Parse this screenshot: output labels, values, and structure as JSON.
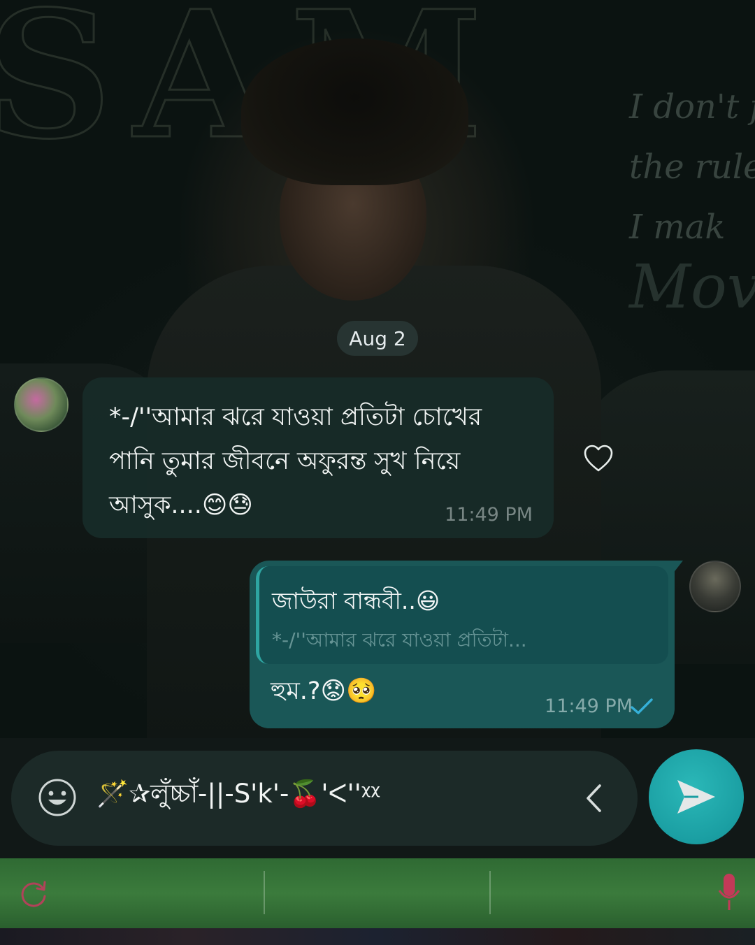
{
  "chat": {
    "date_chip": "Aug 2",
    "incoming": {
      "text": "*-/''আমার ঝরে যাওয়া প্রতিটা চোখের পানি তুমার জীবনে অফুরন্ত সুখ নিয়ে আসুক....😊😓",
      "time": "11:49 PM"
    },
    "outgoing": {
      "reply_name": "জাউরা বান্ধবী..😃",
      "reply_snippet": "*-/''আমার ঝরে যাওয়া প্রতিটা...",
      "text": "হুম.?😟🥺",
      "time": "11:49 PM"
    }
  },
  "composer": {
    "input_value": "🪄✰লুঁচ্চাঁ-||-S'k'-🍒'ᐸ''ᵡᵡ"
  },
  "icons": {
    "heart": "heart-outline-icon",
    "read_check": "check-icon",
    "emoji": "emoji-smile-icon",
    "collapse": "chevron-left-icon",
    "send": "send-icon",
    "keyboard_left": "sync-icon",
    "keyboard_right": "microphone-icon"
  },
  "colors": {
    "incoming_bubble": "#172b28",
    "outgoing_bubble": "#1a5757",
    "send_button": "#1a9ea2",
    "read_check": "#35b0d8",
    "keyboard_strip": "#3b7b3c"
  }
}
